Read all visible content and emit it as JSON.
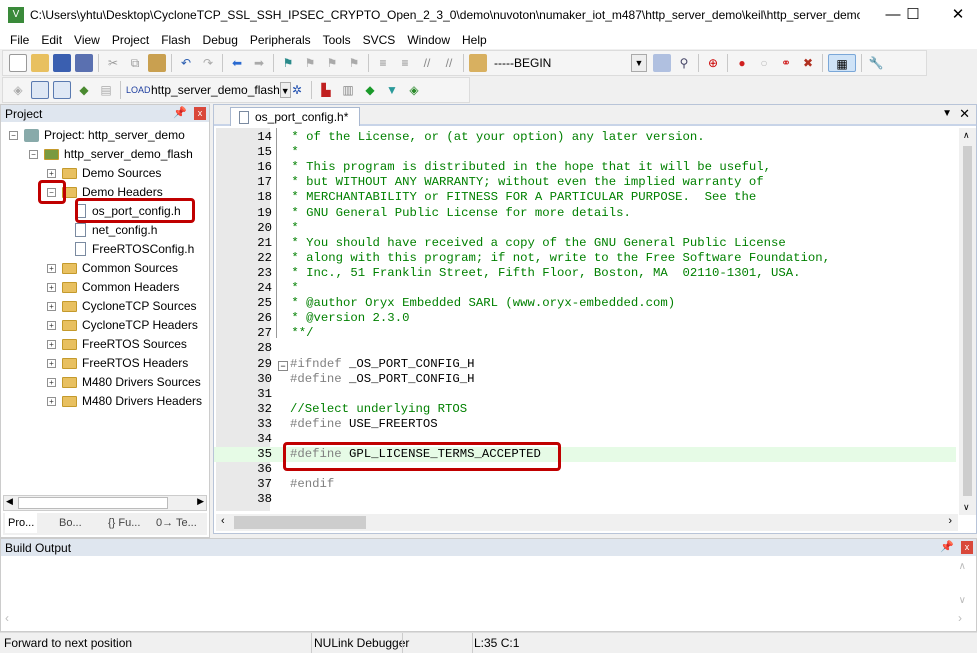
{
  "window": {
    "title": "C:\\Users\\yhtu\\Desktop\\CycloneTCP_SSL_SSH_IPSEC_CRYPTO_Open_2_3_0\\demo\\nuvoton\\numaker_iot_m487\\http_server_demo\\keil\\http_server_demo.uvprojx - ...",
    "app_icon": "keil-uvision-icon",
    "minimize": "—",
    "maximize": "☐",
    "close": "✕"
  },
  "menu": [
    "File",
    "Edit",
    "View",
    "Project",
    "Flash",
    "Debug",
    "Peripherals",
    "Tools",
    "SVCS",
    "Window",
    "Help"
  ],
  "toolbar": {
    "find_combo": "-----BEGIN",
    "target_combo": "http_server_demo_flash"
  },
  "project_panel": {
    "title": "Project",
    "tree": [
      {
        "label": "Project: http_server_demo",
        "type": "project",
        "expanded": true
      },
      {
        "label": "http_server_demo_flash",
        "type": "target",
        "expanded": true
      },
      {
        "label": "Demo Sources",
        "type": "folder",
        "expanded": false
      },
      {
        "label": "Demo Headers",
        "type": "folder",
        "expanded": true
      },
      {
        "label": "os_port_config.h",
        "type": "file",
        "selected": true
      },
      {
        "label": "net_config.h",
        "type": "file"
      },
      {
        "label": "FreeRTOSConfig.h",
        "type": "file"
      },
      {
        "label": "Common Sources",
        "type": "folder",
        "expanded": false
      },
      {
        "label": "Common Headers",
        "type": "folder",
        "expanded": false
      },
      {
        "label": "CycloneTCP Sources",
        "type": "folder",
        "expanded": false
      },
      {
        "label": "CycloneTCP Headers",
        "type": "folder",
        "expanded": false
      },
      {
        "label": "FreeRTOS Sources",
        "type": "folder",
        "expanded": false
      },
      {
        "label": "FreeRTOS Headers",
        "type": "folder",
        "expanded": false
      },
      {
        "label": "M480 Drivers Sources",
        "type": "folder",
        "expanded": false
      },
      {
        "label": "M480 Drivers Headers",
        "type": "folder",
        "expanded": false
      }
    ],
    "tabs": [
      "Pro...",
      "Bo...",
      "{} Fu...",
      "0→ Te..."
    ]
  },
  "editor": {
    "tab": "os_port_config.h*",
    "lines": [
      {
        "n": "14",
        "t": " * of the License, or (at your option) any later version.",
        "k": "cmt"
      },
      {
        "n": "15",
        "t": " *",
        "k": "cmt"
      },
      {
        "n": "16",
        "t": " * This program is distributed in the hope that it will be useful,",
        "k": "cmt"
      },
      {
        "n": "17",
        "t": " * but WITHOUT ANY WARRANTY; without even the implied warranty of",
        "k": "cmt"
      },
      {
        "n": "18",
        "t": " * MERCHANTABILITY or FITNESS FOR A PARTICULAR PURPOSE.  See the",
        "k": "cmt"
      },
      {
        "n": "19",
        "t": " * GNU General Public License for more details.",
        "k": "cmt"
      },
      {
        "n": "20",
        "t": " *",
        "k": "cmt"
      },
      {
        "n": "21",
        "t": " * You should have received a copy of the GNU General Public License",
        "k": "cmt"
      },
      {
        "n": "22",
        "t": " * along with this program; if not, write to the Free Software Foundation,",
        "k": "cmt"
      },
      {
        "n": "23",
        "t": " * Inc., 51 Franklin Street, Fifth Floor, Boston, MA  02110-1301, USA.",
        "k": "cmt"
      },
      {
        "n": "24",
        "t": " *",
        "k": "cmt"
      },
      {
        "n": "25",
        "t": " * @author Oryx Embedded SARL (www.oryx-embedded.com)",
        "k": "cmt"
      },
      {
        "n": "26",
        "t": " * @version 2.3.0",
        "k": "cmt"
      },
      {
        "n": "27",
        "t": " **/",
        "k": "cmt"
      },
      {
        "n": "28",
        "t": "",
        "k": ""
      },
      {
        "n": "29",
        "t": "#ifndef",
        "r": " _OS_PORT_CONFIG_H",
        "k": "pp"
      },
      {
        "n": "30",
        "t": "#define",
        "r": " _OS_PORT_CONFIG_H",
        "k": "pp"
      },
      {
        "n": "31",
        "t": "",
        "k": ""
      },
      {
        "n": "32",
        "t": "//Select underlying RTOS",
        "k": "cmt"
      },
      {
        "n": "33",
        "t": "#define",
        "r": " USE_FREERTOS",
        "k": "pp"
      },
      {
        "n": "34",
        "t": "",
        "k": ""
      },
      {
        "n": "35",
        "t": "#define",
        "r": " GPL_LICENSE_TERMS_ACCEPTED",
        "k": "pp",
        "highlight": true
      },
      {
        "n": "36",
        "t": "",
        "k": ""
      },
      {
        "n": "37",
        "t": "#endif",
        "k": "pp"
      },
      {
        "n": "38",
        "t": "",
        "k": ""
      }
    ]
  },
  "build_output": {
    "title": "Build Output"
  },
  "status": {
    "message": "Forward to next position",
    "debugger": "NULink Debugger",
    "position": "L:35 C:1"
  },
  "colors": {
    "annotation": "#c00000",
    "comment": "#008000",
    "preprocessor": "#808080",
    "current_line": "#e6fbe6"
  }
}
